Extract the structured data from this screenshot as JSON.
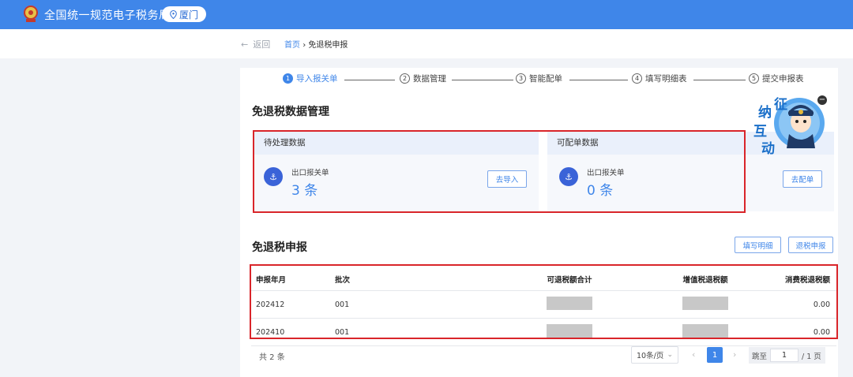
{
  "header": {
    "title": "全国统一规范电子税务局",
    "city": "厦门"
  },
  "breadcrumb": {
    "back_label": "返回",
    "home": "首页",
    "separator": "›",
    "current": "免退税申报"
  },
  "steps": [
    {
      "num": "1",
      "label": "导入报关单",
      "active": true
    },
    {
      "num": "2",
      "label": "数据管理",
      "active": false
    },
    {
      "num": "3",
      "label": "智能配单",
      "active": false
    },
    {
      "num": "4",
      "label": "填写明细表",
      "active": false
    },
    {
      "num": "5",
      "label": "提交申报表",
      "active": false
    }
  ],
  "data_management": {
    "title": "免退税数据管理",
    "pending": {
      "header": "待处理数据",
      "label": "出口报关单",
      "count": "3 条",
      "button": "去导入"
    },
    "matchable": {
      "header": "可配单数据",
      "label": "出口报关单",
      "count": "0 条",
      "button": "去配单"
    }
  },
  "mascot": {
    "text": [
      "征",
      "纳",
      "互",
      "动"
    ]
  },
  "declaration": {
    "title": "免退税申报",
    "buttons": {
      "fill_detail": "填写明细",
      "withdraw": "退税申报"
    },
    "columns": [
      "申报年月",
      "批次",
      "可退税额合计",
      "增值税退税额",
      "消费税退税额"
    ],
    "rows": [
      {
        "period": "202412",
        "batch": "001",
        "consumption_refund": "0.00"
      },
      {
        "period": "202410",
        "batch": "001",
        "consumption_refund": "0.00"
      }
    ]
  },
  "pagination": {
    "total": "共 2 条",
    "page_size": "10条/页",
    "current_page": "1",
    "goto_label": "跳至",
    "goto_value": "1",
    "total_pages": "/ 1 页"
  },
  "colors": {
    "primary": "#3f86e9",
    "highlight_box": "#d9252a",
    "card_icon": "#3a63d8"
  }
}
